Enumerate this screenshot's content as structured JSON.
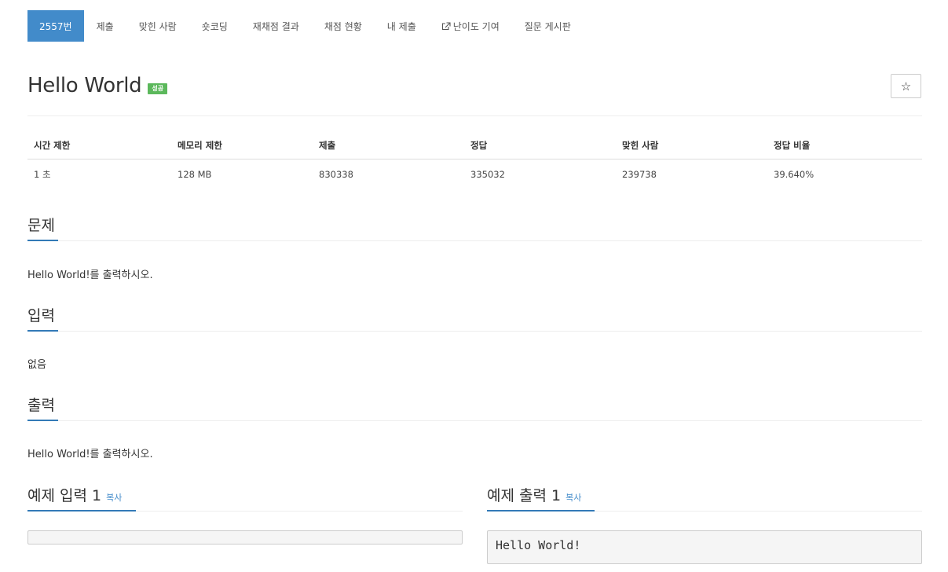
{
  "nav": {
    "items": [
      {
        "label": "2557번",
        "active": true
      },
      {
        "label": "제출"
      },
      {
        "label": "맞힌 사람"
      },
      {
        "label": "숏코딩"
      },
      {
        "label": "재채점 결과"
      },
      {
        "label": "채점 현황"
      },
      {
        "label": "내 제출"
      },
      {
        "label": "난이도 기여",
        "icon": "external-link-icon"
      },
      {
        "label": "질문 게시판"
      }
    ]
  },
  "problem": {
    "title": "Hello World",
    "badge": "성공",
    "star_glyph": "☆"
  },
  "stats": {
    "headers": [
      "시간 제한",
      "메모리 제한",
      "제출",
      "정답",
      "맞힌 사람",
      "정답 비율"
    ],
    "values": [
      "1 초",
      "128 MB",
      "830338",
      "335032",
      "239738",
      "39.640%"
    ]
  },
  "sections": {
    "problem": {
      "heading": "문제",
      "body": "Hello World!를 출력하시오."
    },
    "input": {
      "heading": "입력",
      "body": "없음"
    },
    "output": {
      "heading": "출력",
      "body": "Hello World!를 출력하시오."
    },
    "sample_input": {
      "heading": "예제 입력 1",
      "copy": "복사",
      "content": ""
    },
    "sample_output": {
      "heading": "예제 출력 1",
      "copy": "복사",
      "content": "Hello World!"
    }
  },
  "colors": {
    "active_tab": "#428bca",
    "badge_success": "#5cb85c",
    "section_underline": "#337ab7",
    "link": "#428bca"
  }
}
